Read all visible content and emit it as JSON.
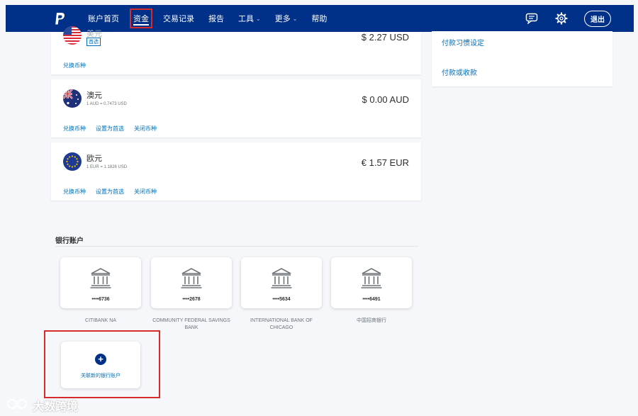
{
  "nav": {
    "items": [
      {
        "label": "账户首页",
        "has_chevron": false
      },
      {
        "label": "资金",
        "has_chevron": false
      },
      {
        "label": "交易记录",
        "has_chevron": false
      },
      {
        "label": "报告",
        "has_chevron": false
      },
      {
        "label": "工具",
        "has_chevron": true
      },
      {
        "label": "更多",
        "has_chevron": true
      },
      {
        "label": "帮助",
        "has_chevron": false
      }
    ],
    "active_item": "资金",
    "chevron": "⌄",
    "logout_label": "退出",
    "icons": [
      "paypal-logo",
      "message-icon",
      "gear-icon"
    ]
  },
  "currencies": [
    {
      "name": "美元",
      "badge": "首选",
      "amount": "$ 2.27 USD",
      "links": [
        "兑换币种"
      ],
      "flag": "us-flag"
    },
    {
      "name": "澳元",
      "rate": "1 AUD = 0.7473 USD",
      "amount": "$ 0.00 AUD",
      "links": [
        "兑换币种",
        "设置为首选",
        "关闭币种"
      ],
      "flag": "au-flag"
    },
    {
      "name": "欧元",
      "rate": "1 EUR = 1.1826 USD",
      "amount": "€ 1.57 EUR",
      "links": [
        "兑换币种",
        "设置为首选",
        "关闭币种"
      ],
      "flag": "eu-flag"
    }
  ],
  "right_panel": {
    "links": [
      "付款习惯设定",
      "付款或收款"
    ]
  },
  "banks": {
    "title": "银行账户",
    "accounts": [
      {
        "number": "••••6736",
        "name": "CITIBANK NA"
      },
      {
        "number": "••••2678",
        "name": "COMMUNITY FEDERAL SAVINGS BANK"
      },
      {
        "number": "••••5634",
        "name": "INTERNATIONAL BANK OF CHICAGO"
      },
      {
        "number": "••••6491",
        "name": "中国招商银行"
      }
    ],
    "add_label": "关联新的银行账户",
    "add_symbol": "+"
  },
  "watermark": {
    "text": "大数跨境"
  },
  "colors": {
    "nav_bg": "#003087",
    "link": "#0070ba",
    "highlight": "#d62b2b"
  }
}
